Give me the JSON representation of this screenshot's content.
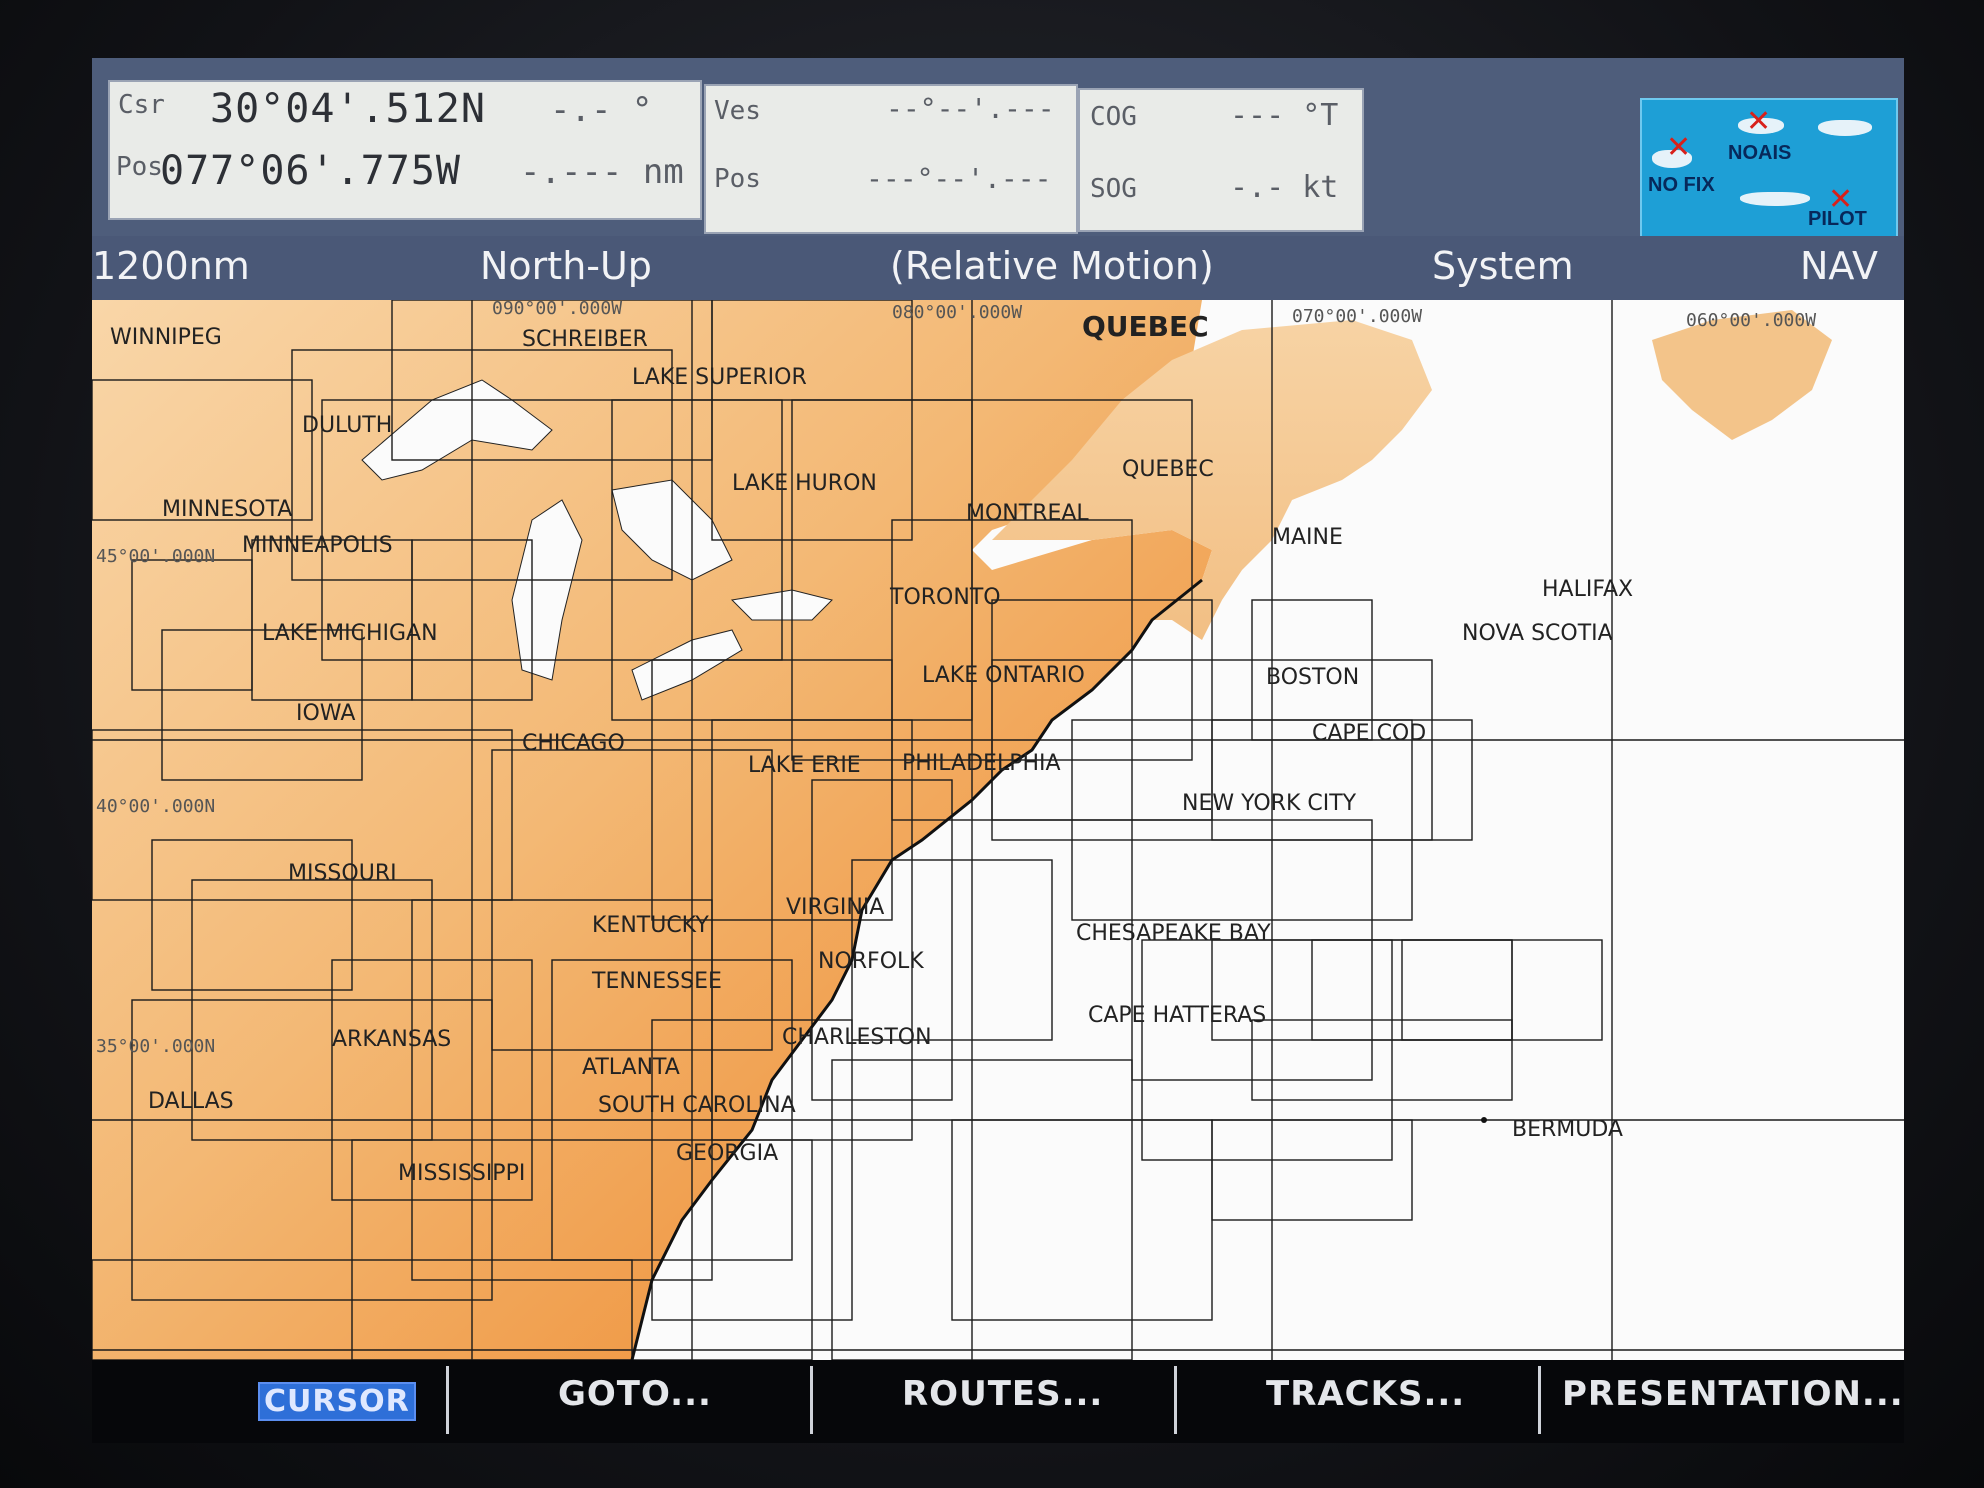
{
  "databox": {
    "crs_label": "Csr",
    "pos_label": "Pos",
    "lat": "30°04'.512N",
    "lon": "077°06'.775W",
    "bearing": "-.- °",
    "range": "-.--- nm",
    "ves_label": "Ves",
    "ves_pos_label": "Pos",
    "ves_lat": "--°--'.---",
    "ves_lon": "---°--'.---",
    "cog_label": "COG",
    "cog_value": "--- °T",
    "sog_label": "SOG",
    "sog_value": "-.- kt"
  },
  "status": {
    "nofix": "NO FIX",
    "noais": "NOAIS",
    "pilot": "PILOT"
  },
  "header": {
    "range": "1200nm",
    "orientation": "North-Up",
    "motion": "(Relative Motion)",
    "system": "System",
    "mode": "NAV"
  },
  "chart_labels": {
    "lon_090": "090°00'.000W",
    "lon_080": "080°00'.000W",
    "lon_070": "070°00'.000W",
    "lon_060": "060°00'.000W",
    "lat_45": "45°00'.000N",
    "lat_40": "40°00'.000N",
    "lat_35": "35°00'.000N",
    "places": [
      "WINNIPEG",
      "SCHREIBER",
      "QUEBEC",
      "LAKE SUPERIOR",
      "DULUTH",
      "LAKE HURON",
      "QUEBEC",
      "MINNESOTA",
      "MONTREAL",
      "MAINE",
      "MINNEAPOLIS",
      "HALIFAX",
      "TORONTO",
      "LAKE MICHIGAN",
      "NOVA SCOTIA",
      "LAKE ONTARIO",
      "BOSTON",
      "IOWA",
      "CAPE COD",
      "CHICAGO",
      "LAKE ERIE",
      "PHILADELPHIA",
      "NEW YORK CITY",
      "MISSOURI",
      "VIRGINIA",
      "CHESAPEAKE BAY",
      "KENTUCKY",
      "NORFOLK",
      "TENNESSEE",
      "CAPE HATTERAS",
      "ARKANSAS",
      "CHARLESTON",
      "ATLANTA",
      "DALLAS",
      "SOUTH CAROLINA",
      "BERMUDA",
      "GEORGIA",
      "MISSISSIPPI"
    ]
  },
  "softkeys": [
    "CURSOR",
    "GOTO...",
    "ROUTES...",
    "TRACKS...",
    "PRESENTATION..."
  ],
  "colors": {
    "land_warm": "#f08a2e",
    "land_light": "#f4c48e",
    "water": "#ffffff",
    "header": "#4a5877",
    "softkey_selected": "#2e6fd8"
  }
}
